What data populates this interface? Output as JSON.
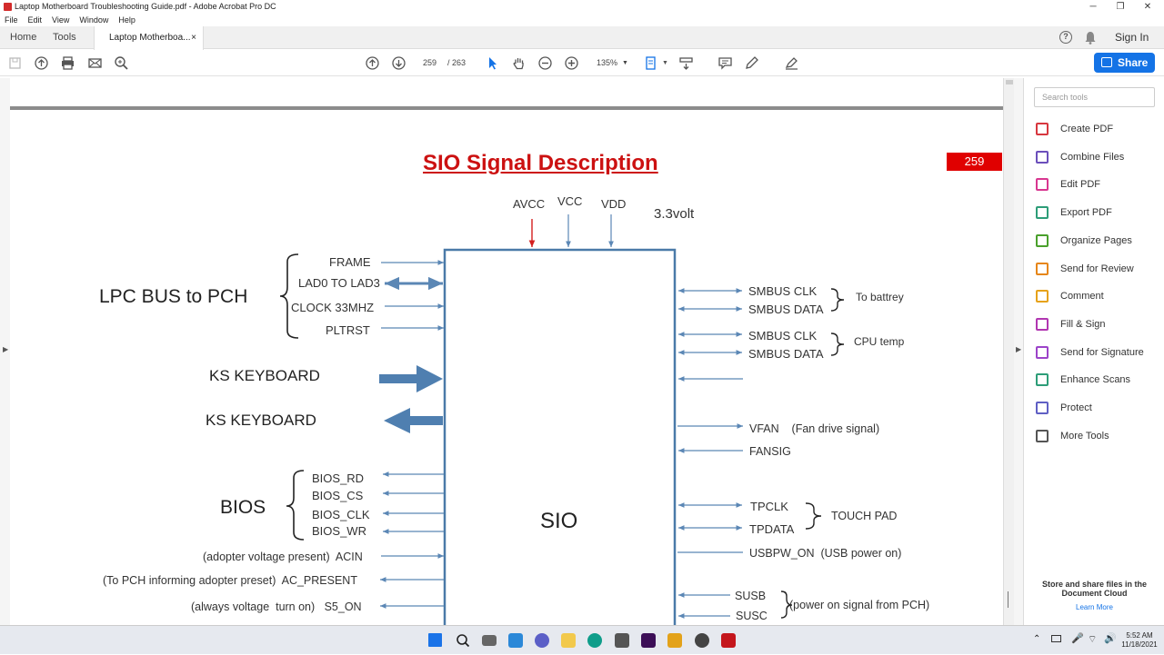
{
  "window": {
    "title": "Laptop Motherboard Troubleshooting Guide.pdf - Adobe Acrobat Pro DC",
    "minimize": "─",
    "maximize": "❐",
    "close": "✕"
  },
  "menu": [
    "File",
    "Edit",
    "View",
    "Window",
    "Help"
  ],
  "tabs": {
    "home": "Home",
    "tools": "Tools",
    "document": "Laptop Motherboa...",
    "close": "×",
    "signin": "Sign In"
  },
  "toolbar": {
    "page_current": "259",
    "page_total": "/ 263",
    "zoom": "135%",
    "share": "Share"
  },
  "page": {
    "title": "SIO Signal Description",
    "page_badge": "259",
    "chip_label": "SIO",
    "power": {
      "avcc": "AVCC",
      "vcc": "VCC",
      "vdd": "VDD",
      "volt": "3.3volt"
    },
    "lpc_group": "LPC BUS to PCH",
    "lpc_signals": [
      "FRAME",
      "LAD0 TO LAD3",
      "CLOCK 33MHZ",
      "PLTRST"
    ],
    "keyboard_in": "KS KEYBOARD",
    "keyboard_out": "KS KEYBOARD",
    "bios_group": "BIOS",
    "bios_signals": [
      "BIOS_RD",
      "BIOS_CS",
      "BIOS_CLK",
      "BIOS_WR"
    ],
    "left_misc": [
      "(adopter voltage present)  ACIN",
      "(To PCH informing adopter preset)  AC_PRESENT",
      "(always voltage  turn on)   S5_ON"
    ],
    "smbus1": [
      "SMBUS CLK",
      "SMBUS DATA"
    ],
    "smbus1_label": "To battrey",
    "smbus2": [
      "SMBUS CLK",
      "SMBUS DATA"
    ],
    "smbus2_label": "CPU temp",
    "vfan": "VFAN    (Fan drive signal)",
    "fansig": "FANSIG",
    "touch": [
      "TPCLK",
      "TPDATA"
    ],
    "touch_label": "TOUCH PAD",
    "usbpw": "USBPW_ON  (USB power on)",
    "susb": [
      "SUSB",
      "SUSC"
    ],
    "susb_label": "(power on signal from PCH)"
  },
  "right_pane": {
    "search_placeholder": "Search tools",
    "tools": [
      {
        "label": "Create PDF",
        "color": "#d7373f"
      },
      {
        "label": "Combine Files",
        "color": "#6b4fbb"
      },
      {
        "label": "Edit PDF",
        "color": "#d83790"
      },
      {
        "label": "Export PDF",
        "color": "#2d9d78"
      },
      {
        "label": "Organize Pages",
        "color": "#4aa02c"
      },
      {
        "label": "Send for Review",
        "color": "#e68619"
      },
      {
        "label": "Comment",
        "color": "#e6a21a"
      },
      {
        "label": "Fill & Sign",
        "color": "#b136b1"
      },
      {
        "label": "Send for Signature",
        "color": "#9c43c9"
      },
      {
        "label": "Enhance Scans",
        "color": "#2d9d78"
      },
      {
        "label": "Protect",
        "color": "#5f5fc4"
      },
      {
        "label": "More Tools",
        "color": "#555555"
      }
    ],
    "cloud_text_1": "Store and share files in the",
    "cloud_text_2": "Document Cloud",
    "learn_more": "Learn More"
  },
  "taskbar": {
    "time": "5:52 AM",
    "date": "11/18/2021"
  }
}
